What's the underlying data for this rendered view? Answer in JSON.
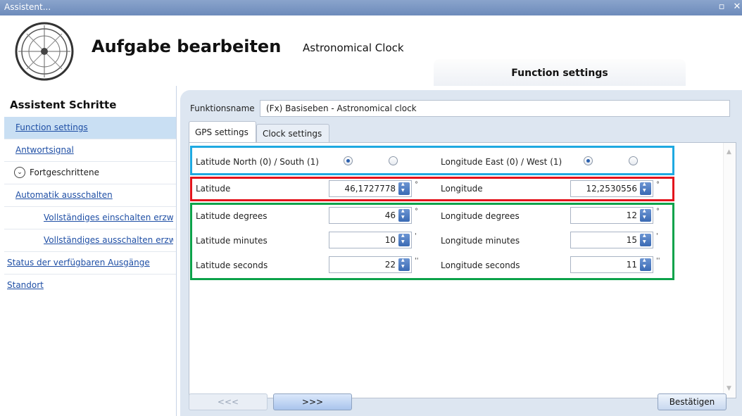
{
  "window": {
    "title": "Assistent..."
  },
  "header": {
    "title": "Aufgabe bearbeiten",
    "subtitle": "Astronomical Clock",
    "tab_label": "Function settings"
  },
  "sidebar": {
    "heading": "Assistent Schritte",
    "items": [
      {
        "label": "Function settings"
      },
      {
        "label": "Antwortsignal"
      },
      {
        "label": "Fortgeschrittene"
      },
      {
        "label": "Automatik ausschalten"
      },
      {
        "label": "Vollständiges einschalten erzw"
      },
      {
        "label": "Vollständiges ausschalten erzw"
      },
      {
        "label": "Status der verfügbaren Ausgänge"
      },
      {
        "label": "Standort"
      }
    ]
  },
  "form": {
    "function_name_label": "Funktionsname",
    "function_name_value": "(Fx) Basiseben - Astronomical clock",
    "tabs": [
      {
        "label": "GPS settings"
      },
      {
        "label": "Clock settings"
      }
    ],
    "lat_ns_label": "Latitude North (0) / South (1)",
    "lon_ew_label": "Longitude East (0) / West (1)",
    "latitude_label": "Latitude",
    "latitude_value": "46,1727778",
    "longitude_label": "Longitude",
    "longitude_value": "12,2530556",
    "lat_deg_label": "Latitude degrees",
    "lat_deg_value": "46",
    "lon_deg_label": "Longitude degrees",
    "lon_deg_value": "12",
    "lat_min_label": "Latitude minutes",
    "lat_min_value": "10",
    "lon_min_label": "Longitude minutes",
    "lon_min_value": "15",
    "lat_sec_label": "Latitude seconds",
    "lat_sec_value": "22",
    "lon_sec_label": "Longitude seconds",
    "lon_sec_value": "11",
    "unit_degree": "°",
    "unit_minute": "'",
    "unit_second": "''"
  },
  "buttons": {
    "prev": "<<<",
    "next": ">>>",
    "confirm": "Bestätigen"
  },
  "colors": {
    "blue_box": "#1ea9e1",
    "red_box": "#e3141c",
    "green_box": "#0ca24a"
  }
}
